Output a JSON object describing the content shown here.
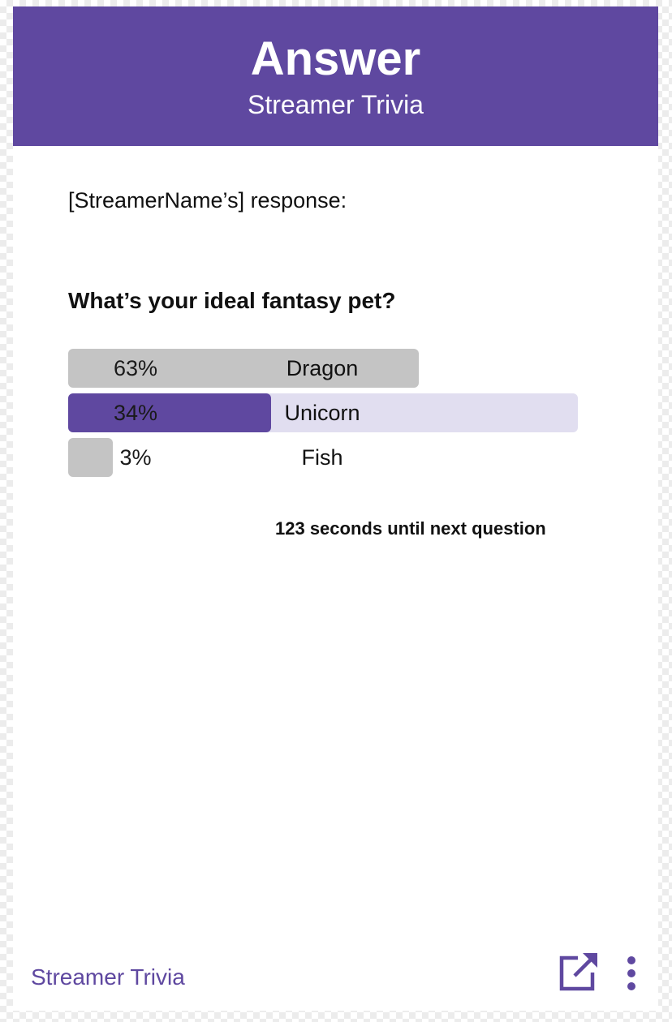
{
  "header": {
    "title": "Answer",
    "subtitle": "Streamer Trivia"
  },
  "response_label": "[StreamerName’s] response:",
  "question": "What’s your ideal fantasy pet?",
  "options": [
    {
      "percent_label": "63%",
      "label": "Dragon",
      "percent": 63,
      "selected": false
    },
    {
      "percent_label": "34%",
      "label": "Unicorn",
      "percent": 34,
      "selected": true
    },
    {
      "percent_label": "3%",
      "label": "Fish",
      "percent": 3,
      "selected": false
    }
  ],
  "timer_text": "123 seconds until next question",
  "footer": {
    "title": "Streamer Trivia",
    "icons": {
      "popout": "external-link-icon",
      "more": "more-vertical-icon"
    }
  },
  "colors": {
    "accent": "#5f48a0",
    "bar_neutral": "#c4c4c4",
    "selected_track": "#e1def0",
    "text": "#111111"
  }
}
